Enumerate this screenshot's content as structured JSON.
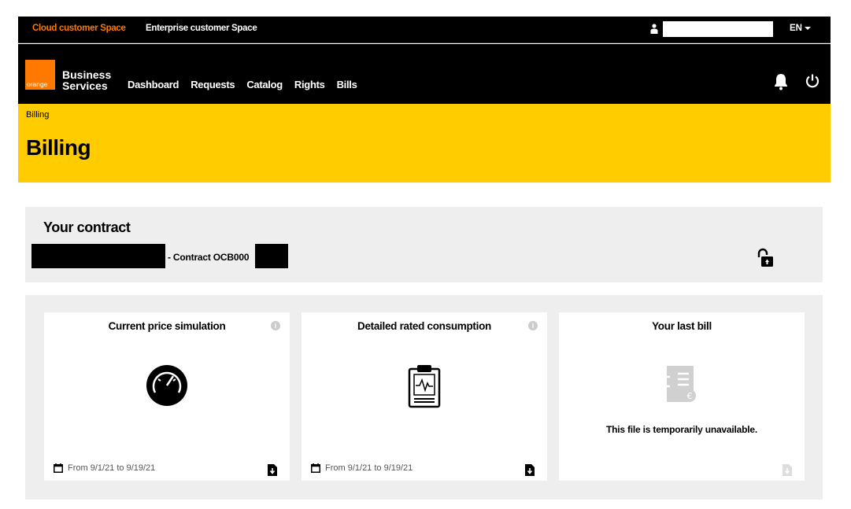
{
  "topbar": {
    "cloud_space": "Cloud customer Space",
    "enterprise_space": "Enterprise customer Space",
    "language": "EN"
  },
  "nav": {
    "logo_text": "orange",
    "brand_line1": "Business",
    "brand_line2": "Services",
    "items": [
      {
        "label": "Dashboard"
      },
      {
        "label": "Requests"
      },
      {
        "label": "Catalog"
      },
      {
        "label": "Rights"
      },
      {
        "label": "Bills"
      }
    ]
  },
  "page": {
    "breadcrumb": "Billing",
    "title": "Billing"
  },
  "contract": {
    "title": "Your contract",
    "contract_text": "- Contract OCB000"
  },
  "cards": [
    {
      "title": "Current price simulation",
      "info_icon": "i",
      "date_range": "From 9/1/21 to 9/19/21"
    },
    {
      "title": "Detailed rated consumption",
      "info_icon": "i",
      "date_range": "From 9/1/21 to 9/19/21"
    },
    {
      "title": "Your last bill",
      "message": "This file is temporarily unavailable."
    }
  ],
  "colors": {
    "orange": "#ff7900",
    "yellow": "#ffcc00",
    "panel": "#eeeeee"
  }
}
